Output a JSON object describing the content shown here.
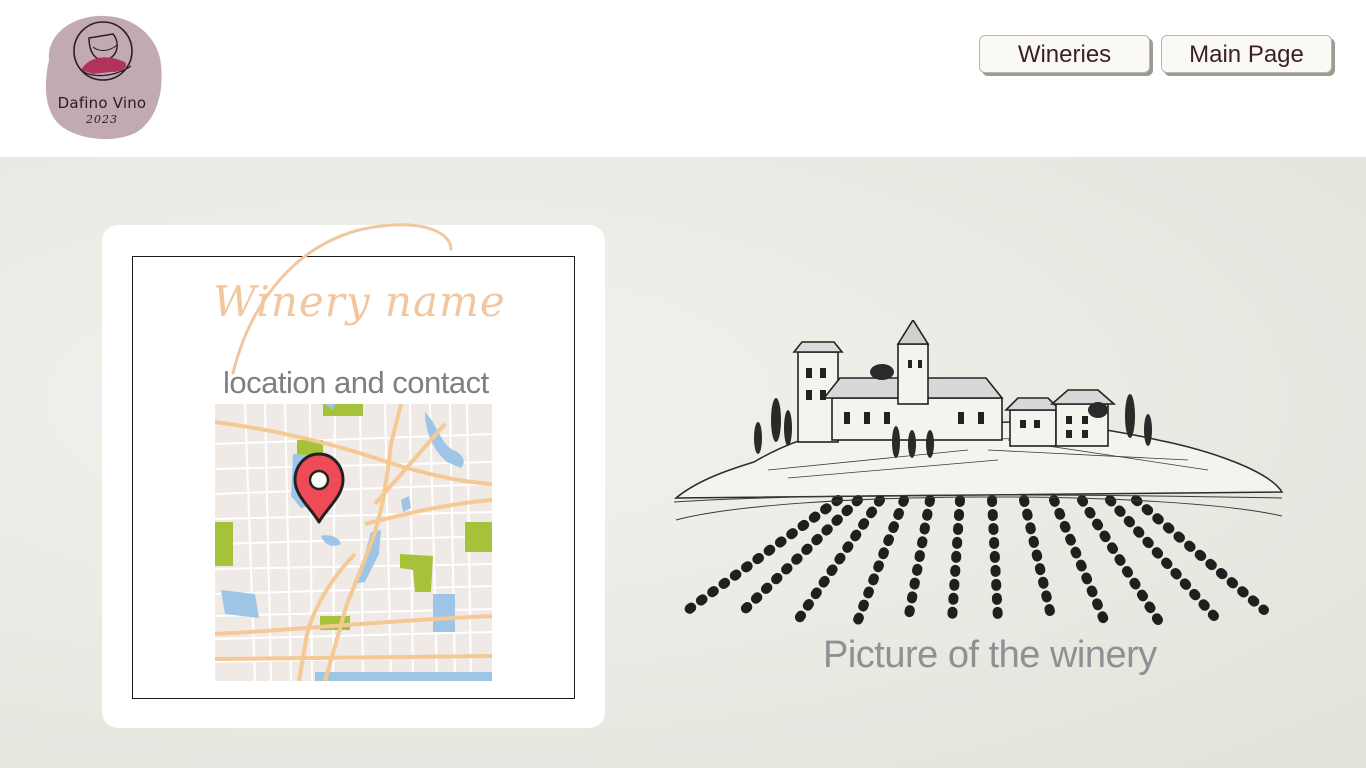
{
  "brand": {
    "name": "Dafino Vino",
    "year": "2023",
    "icon": "wine-glass-hand-icon",
    "badge_color": "#c2aab4"
  },
  "nav": {
    "wineries_label": "Wineries",
    "main_page_label": "Main Page"
  },
  "card": {
    "title": "Winery name",
    "subtitle": "location and contact",
    "map_icon": "location-pin-icon"
  },
  "picture": {
    "caption": "Picture of the winery",
    "illustration": "vineyard-sketch"
  },
  "colors": {
    "accent_peach": "#f1c79f",
    "pin_red": "#ef4b57",
    "text_gray": "#7d7f82",
    "button_text": "#3a1f2a"
  }
}
